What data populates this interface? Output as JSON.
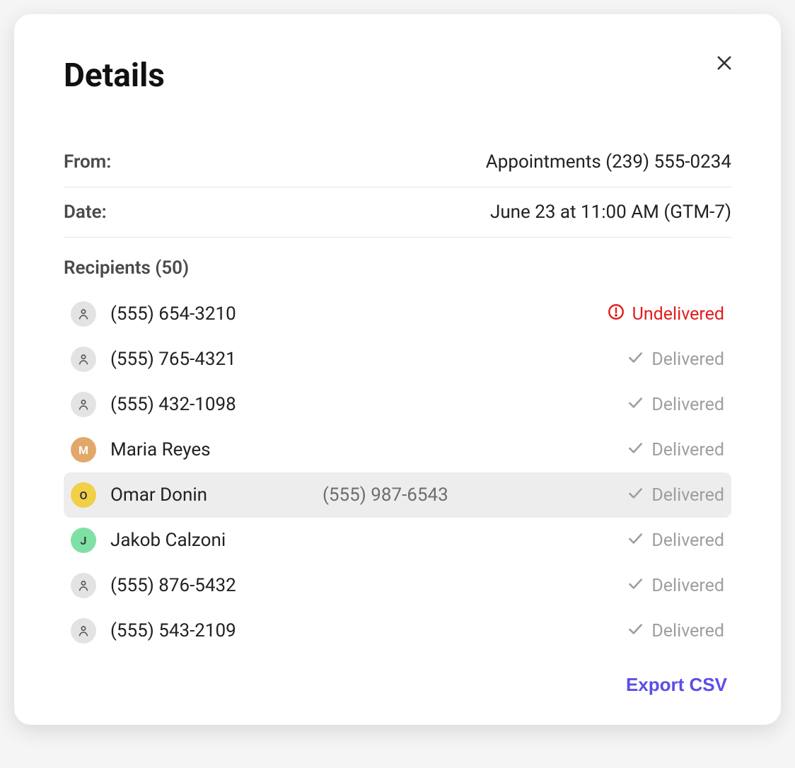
{
  "modal": {
    "title": "Details",
    "from_label": "From:",
    "from_value": "Appointments (239) 555-0234",
    "date_label": "Date:",
    "date_value": "June 23 at 11:00 AM (GTM-7)",
    "recipients_label": "Recipients (50)",
    "export_label": "Export CSV"
  },
  "status_labels": {
    "delivered": "Delivered",
    "undelivered": "Undelivered"
  },
  "recipients": [
    {
      "name": "(555) 654-3210",
      "phone": "",
      "avatar": "generic",
      "initial": "",
      "status": "undelivered",
      "hover": false
    },
    {
      "name": "(555) 765-4321",
      "phone": "",
      "avatar": "generic",
      "initial": "",
      "status": "delivered",
      "hover": false
    },
    {
      "name": "(555) 432-1098",
      "phone": "",
      "avatar": "generic",
      "initial": "",
      "status": "delivered",
      "hover": false
    },
    {
      "name": "Maria Reyes",
      "phone": "",
      "avatar": "orange",
      "initial": "M",
      "status": "delivered",
      "hover": false
    },
    {
      "name": "Omar Donin",
      "phone": "(555) 987-6543",
      "avatar": "yellow",
      "initial": "O",
      "status": "delivered",
      "hover": true
    },
    {
      "name": "Jakob Calzoni",
      "phone": "",
      "avatar": "green",
      "initial": "J",
      "status": "delivered",
      "hover": false
    },
    {
      "name": "(555) 876-5432",
      "phone": "",
      "avatar": "generic",
      "initial": "",
      "status": "delivered",
      "hover": false
    },
    {
      "name": "(555) 543-2109",
      "phone": "",
      "avatar": "generic",
      "initial": "",
      "status": "delivered",
      "hover": false
    }
  ],
  "colors": {
    "undelivered": "#e11d1d",
    "delivered": "#9e9e9e",
    "accent": "#5b4de6"
  }
}
